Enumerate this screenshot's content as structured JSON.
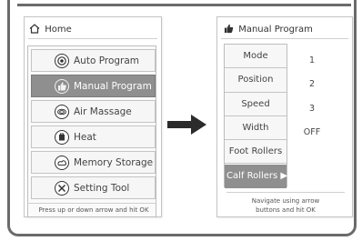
{
  "home_panel": {
    "title": "Home",
    "menu": [
      {
        "label": "Auto Program",
        "icon": "auto-program-icon",
        "selected": false
      },
      {
        "label": "Manual Program",
        "icon": "thumbs-up-icon",
        "selected": true
      },
      {
        "label": "Air Massage",
        "icon": "air-massage-icon",
        "selected": false
      },
      {
        "label": "Heat",
        "icon": "heat-icon",
        "selected": false
      },
      {
        "label": "Memory Storage",
        "icon": "memory-storage-icon",
        "selected": false
      },
      {
        "label": "Setting Tool",
        "icon": "setting-tool-icon",
        "selected": false
      }
    ],
    "hint": "Press up or down arrow and hit OK"
  },
  "manual_panel": {
    "title": "Manual Program",
    "rows": [
      {
        "label": "Mode",
        "value": "1"
      },
      {
        "label": "Position",
        "value": "2"
      },
      {
        "label": "Speed",
        "value": "3"
      },
      {
        "label": "Width",
        "value": "OFF"
      },
      {
        "label": "Foot Rollers",
        "value": ""
      },
      {
        "label": "Calf Rollers ▶",
        "value": "",
        "selected": true
      }
    ],
    "hint_line1": "Navigate using arrow",
    "hint_line2": "buttons and hit OK"
  },
  "colors": {
    "selected_bg": "#8f8f8f",
    "frame": "#6b6b6b",
    "arrow": "#2b2b2b"
  }
}
